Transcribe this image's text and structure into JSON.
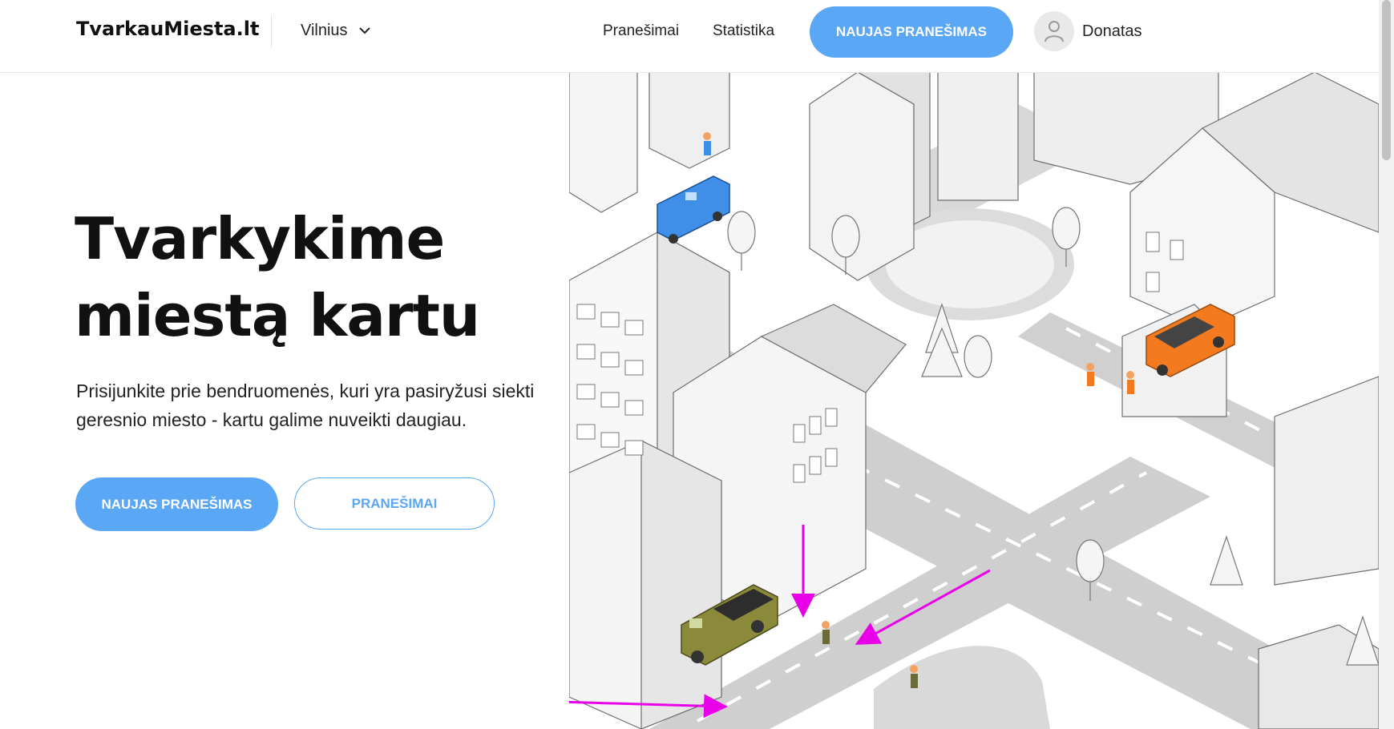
{
  "header": {
    "logo": "TvarkauMiesta.lt",
    "city_selector": "Vilnius",
    "nav": {
      "reports_label": "Pranešimai",
      "stats_label": "Statistika",
      "new_report_label": "NAUJAS PRANEŠIMAS"
    },
    "user": {
      "name": "Donatas"
    }
  },
  "hero": {
    "title_line1": "Tvarkykime",
    "title_line2": "miestą kartu",
    "description": "Prisijunkite prie bendruomenės, kuri yra pasiryžusi siekti geresnio miesto - kartu galime nuveikti daugiau.",
    "primary_button": "NAUJAS PRANEŠIMAS",
    "secondary_button": "PRANEŠIMAI"
  },
  "colors": {
    "accent": "#5aa7f5",
    "annotation_arrow": "#e800e8",
    "van_blue": "#3f8fe8",
    "truck_orange": "#f47a20",
    "truck_olive": "#8a8a3a"
  },
  "icons": {
    "city_dropdown": "chevron-down-icon",
    "user": "user-icon"
  }
}
